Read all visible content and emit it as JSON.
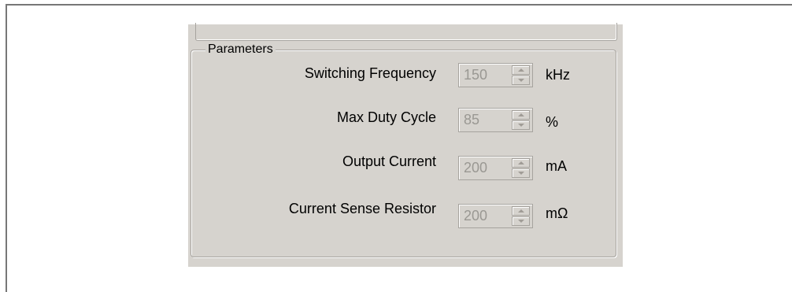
{
  "group_title": "Parameters",
  "rows": [
    {
      "label": "Switching Frequency",
      "value": "150",
      "unit": "kHz"
    },
    {
      "label": "Max Duty Cycle",
      "value": "85",
      "unit": "%"
    },
    {
      "label": "Output Current",
      "value": "200",
      "unit": "mA"
    },
    {
      "label": "Current Sense Resistor",
      "value": "200",
      "unit": "mΩ"
    }
  ],
  "icons": {
    "increment": "triangle-up",
    "decrement": "triangle-down"
  },
  "colors": {
    "panel_background": "#d6d3ce",
    "disabled_text": "#9a9893",
    "top_clipped_text": "#1f3fbf"
  }
}
